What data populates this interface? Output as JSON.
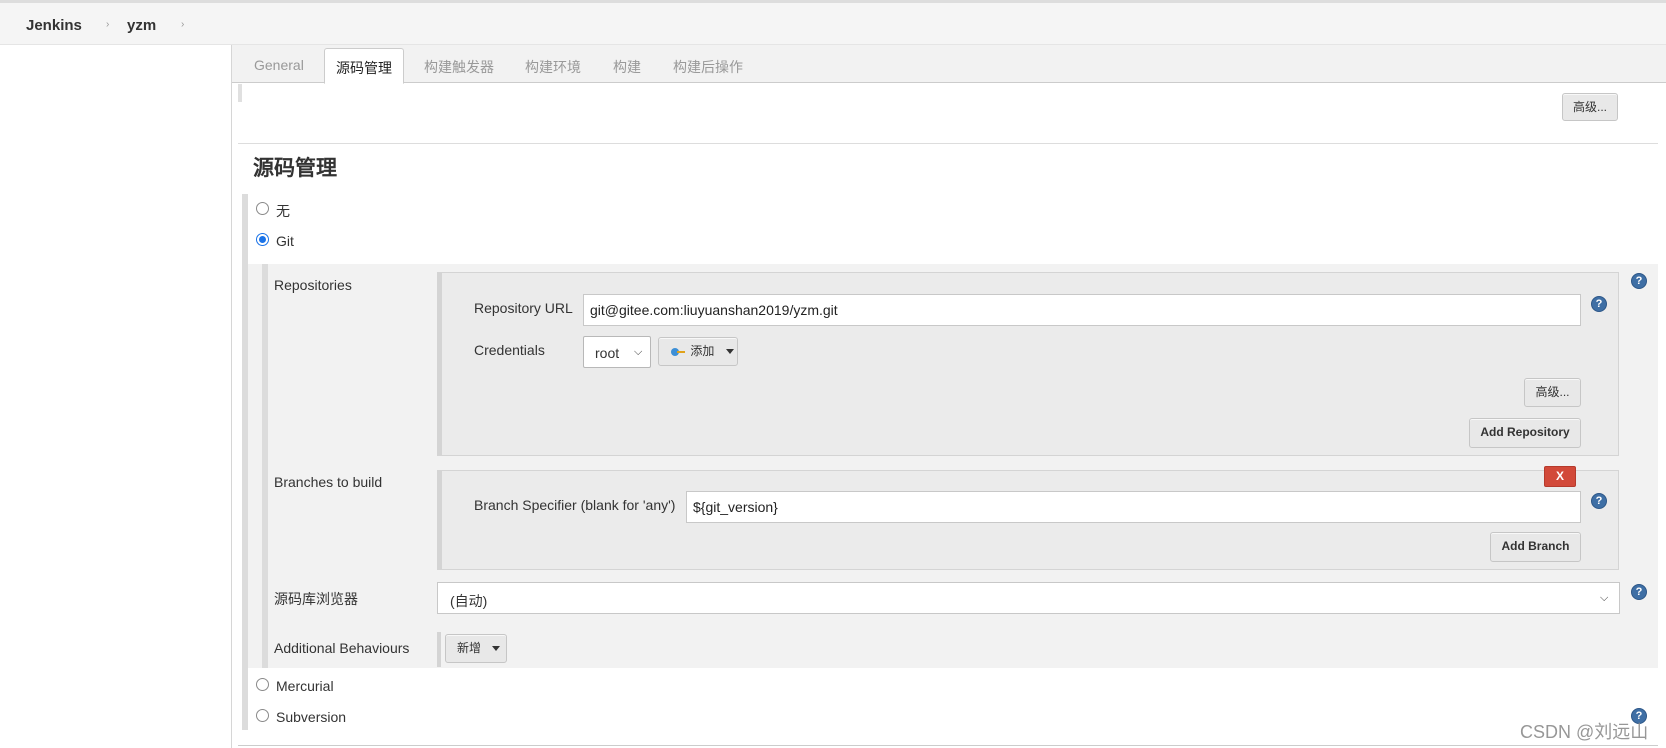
{
  "breadcrumb": {
    "items": [
      "Jenkins",
      "yzm"
    ],
    "separator": "›"
  },
  "tabs": [
    "General",
    "源码管理",
    "构建触发器",
    "构建环境",
    "构建",
    "构建后操作"
  ],
  "active_tab": "源码管理",
  "top_advanced_button": "高级...",
  "section_title": "源码管理",
  "scm_options": [
    {
      "label": "无",
      "checked": false
    },
    {
      "label": "Git",
      "checked": true
    },
    {
      "label": "Mercurial",
      "checked": false
    },
    {
      "label": "Subversion",
      "checked": false
    }
  ],
  "git": {
    "repositories_label": "Repositories",
    "repository_url_label": "Repository URL",
    "repository_url_value": "git@gitee.com:liuyuanshan2019/yzm.git",
    "credentials_label": "Credentials",
    "credentials_value": "root",
    "add_button_label": "添加",
    "repo_advanced_button": "高级...",
    "add_repository_button": "Add Repository",
    "branches_label": "Branches to build",
    "delete_branch_button": "X",
    "branch_specifier_label": "Branch Specifier (blank for 'any')",
    "branch_specifier_value": "${git_version}",
    "add_branch_button": "Add Branch",
    "repo_browser_label": "源码库浏览器",
    "repo_browser_value": "(自动)",
    "additional_behaviours_label": "Additional Behaviours",
    "add_behaviour_button": "新增"
  },
  "help_glyph": "?",
  "watermark": "CSDN @刘远山",
  "colors": {
    "accent_blue": "#3f6fa5",
    "danger_red": "#d24939",
    "panel_gray": "#ebebeb"
  }
}
